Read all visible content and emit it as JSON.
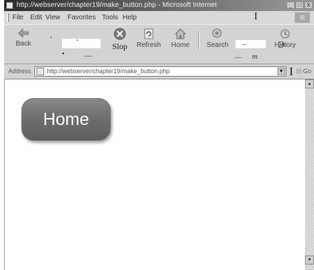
{
  "window": {
    "title": "http://webserver/chapter19/make_button.php - Microsoft Internet",
    "buttons": [
      "_",
      "□",
      "X"
    ]
  },
  "menu": {
    "items": [
      "File",
      "Edit",
      "View",
      "Favorites",
      "Tools",
      "Help"
    ],
    "cursor_glyph": "I"
  },
  "toolbar": {
    "back_label": "Back",
    "stop_label": "Slop",
    "refresh_label": "Refresh",
    "home_label": "Home",
    "search_label": "Search",
    "history_label": "History",
    "artifacts": [
      "·",
      "•",
      ".....",
      "_",
      "m",
      "Э",
      "....."
    ]
  },
  "address": {
    "label": "Address",
    "url": "http://webserver/chapter19/make_button.php",
    "cursor_glyph": "I",
    "go_label": "Go"
  },
  "page": {
    "home_button_label": "Home",
    "button_color": "#6f6f6f"
  },
  "scrollbar": {
    "up_arrow": "▲",
    "down_arrow": "▼"
  }
}
